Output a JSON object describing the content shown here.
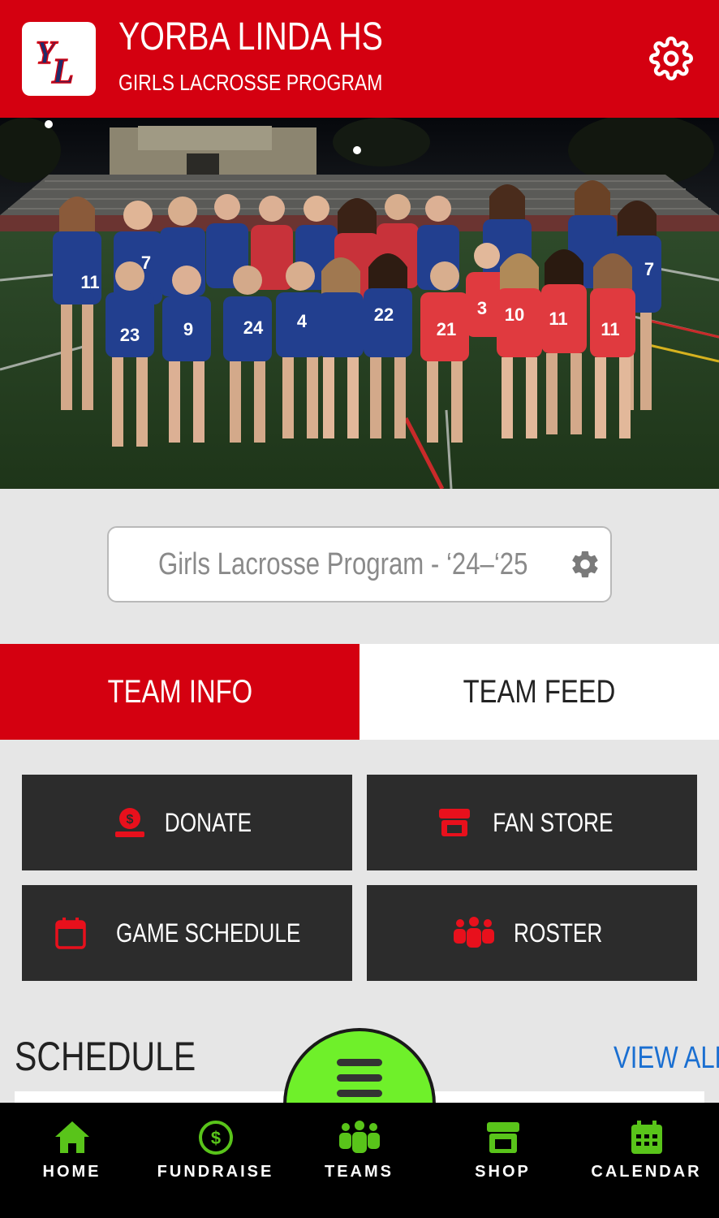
{
  "header": {
    "school_name": "YORBA LINDA HS",
    "program_name": "GIRLS LACROSSE PROGRAM",
    "logo_text": "YL"
  },
  "photo": {
    "jersey_numbers": [
      "11",
      "7",
      "23",
      "9",
      "24",
      "4",
      "22",
      "21",
      "3",
      "10",
      "11",
      "7",
      "11"
    ]
  },
  "season": {
    "label": "Girls Lacrosse Program - ‘24–‘25"
  },
  "tabs": [
    {
      "label": "TEAM INFO",
      "active": true
    },
    {
      "label": "TEAM FEED",
      "active": false
    }
  ],
  "actions": [
    {
      "label": "DONATE",
      "icon": "donate-icon"
    },
    {
      "label": "FAN STORE",
      "icon": "store-icon"
    },
    {
      "label": "GAME SCHEDULE",
      "icon": "calendar-icon"
    },
    {
      "label": "ROSTER",
      "icon": "team-icon"
    }
  ],
  "schedule": {
    "title": "SCHEDULE",
    "view_all": "VIEW ALL"
  },
  "bottom_nav": [
    {
      "label": "HOME",
      "icon": "home-icon"
    },
    {
      "label": "FUNDRAISE",
      "icon": "dollar-icon"
    },
    {
      "label": "TEAMS",
      "icon": "team-icon"
    },
    {
      "label": "SHOP",
      "icon": "store-icon"
    },
    {
      "label": "CALENDAR",
      "icon": "calendar-icon"
    }
  ],
  "colors": {
    "brand_red": "#d40010",
    "dark_button": "#2c2c2c",
    "fab_green": "#6ff02a",
    "nav_icon_green": "#59c41a",
    "link_blue": "#1a6fd1"
  }
}
